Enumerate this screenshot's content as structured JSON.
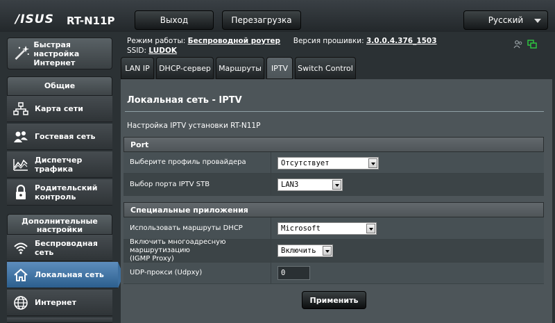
{
  "header": {
    "logo": "/ISUS",
    "model": "RT-N11P",
    "logout_label": "Выход",
    "reboot_label": "Перезагрузка",
    "language": "Русский"
  },
  "info": {
    "mode_label": "Режим работы:",
    "mode_value": "Беспроводной роутер",
    "firmware_label": "Версия прошивки:",
    "firmware_value": "3.0.0.4.376_1503",
    "ssid_label": "SSID:",
    "ssid_value": "LUDOK"
  },
  "sidebar": {
    "quick_setup_line1": "Быстрая настройка",
    "quick_setup_line2": "Интернет",
    "general_header": "Общие",
    "general_items": [
      {
        "line1": "Карта сети",
        "line2": ""
      },
      {
        "line1": "Гостевая сеть",
        "line2": ""
      },
      {
        "line1": "Диспетчер",
        "line2": "трафика"
      },
      {
        "line1": "Родительский",
        "line2": "контроль"
      }
    ],
    "advanced_header_line1": "Дополнительные",
    "advanced_header_line2": "настройки",
    "advanced_items": [
      {
        "line1": "Беспроводная",
        "line2": "сеть"
      },
      {
        "line1": "Локальная сеть",
        "line2": ""
      },
      {
        "line1": "Интернет",
        "line2": ""
      }
    ]
  },
  "tabs": [
    {
      "label": "LAN IP"
    },
    {
      "label": "DHCP-сервер"
    },
    {
      "label": "Маршруты"
    },
    {
      "label": "IPTV"
    },
    {
      "label": "Switch Control"
    }
  ],
  "main": {
    "title": "Локальная сеть - IPTV",
    "description": "Настройка IPTV установки RT-N11P",
    "section_port": "Port",
    "provider_label": "Выберите профиль провайдера",
    "provider_value": "Отсутствует",
    "stb_port_label": "Выбор порта IPTV STB",
    "stb_port_value": "LAN3",
    "section_special": "Специальные приложения",
    "dhcp_routes_label": "Использовать маршруты DHCP",
    "dhcp_routes_value": "Microsoft",
    "igmp_label_line1": "Включить многоадресную маршрутизацию",
    "igmp_label_line2": "(IGMP Proxy)",
    "igmp_value": "Включить",
    "udpxy_label": "UDP-прокси (Udpxy)",
    "udpxy_value": "0",
    "apply_label": "Применить"
  },
  "colors": {
    "accent": "#3d6f9f",
    "panel": "#4d5559",
    "background": "#2b3134"
  }
}
